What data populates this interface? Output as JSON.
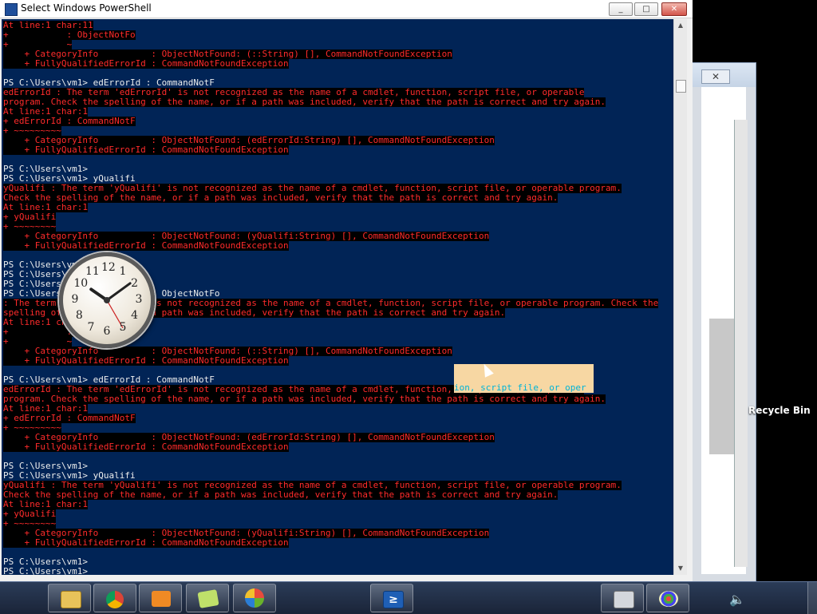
{
  "window": {
    "title": "Select Windows PowerShell",
    "minimize_label": "_",
    "maximize_label": "□",
    "close_label": "✕"
  },
  "console": {
    "lines": [
      {
        "t": "At line:1 char:11",
        "k": "err"
      },
      {
        "t": "+           : ObjectNotFo",
        "k": "err"
      },
      {
        "t": "+           ~",
        "k": "err"
      },
      {
        "t": "    + CategoryInfo          : ObjectNotFound: (::String) [], CommandNotFoundException",
        "k": "err"
      },
      {
        "t": "    + FullyQualifiedErrorId : CommandNotFoundException",
        "k": "err"
      },
      {
        "t": "",
        "k": "norm"
      },
      {
        "t": "PS C:\\Users\\vm1> edErrorId : CommandNotF",
        "k": "norm"
      },
      {
        "t": "edErrorId : The term 'edErrorId' is not recognized as the name of a cmdlet, function, script file, or operable",
        "k": "err"
      },
      {
        "t": "program. Check the spelling of the name, or if a path was included, verify that the path is correct and try again.",
        "k": "err"
      },
      {
        "t": "At line:1 char:1",
        "k": "err"
      },
      {
        "t": "+ edErrorId : CommandNotF",
        "k": "err"
      },
      {
        "t": "+ ~~~~~~~~~",
        "k": "err"
      },
      {
        "t": "    + CategoryInfo          : ObjectNotFound: (edErrorId:String) [], CommandNotFoundException",
        "k": "err"
      },
      {
        "t": "    + FullyQualifiedErrorId : CommandNotFoundException",
        "k": "err"
      },
      {
        "t": "",
        "k": "norm"
      },
      {
        "t": "PS C:\\Users\\vm1>",
        "k": "norm"
      },
      {
        "t": "PS C:\\Users\\vm1> yQualifi",
        "k": "norm"
      },
      {
        "t": "yQualifi : The term 'yQualifi' is not recognized as the name of a cmdlet, function, script file, or operable program.",
        "k": "err"
      },
      {
        "t": "Check the spelling of the name, or if a path was included, verify that the path is correct and try again.",
        "k": "err"
      },
      {
        "t": "At line:1 char:1",
        "k": "err"
      },
      {
        "t": "+ yQualifi",
        "k": "err"
      },
      {
        "t": "+ ~~~~~~~~",
        "k": "err"
      },
      {
        "t": "    + CategoryInfo          : ObjectNotFound: (yQualifi:String) [], CommandNotFoundException",
        "k": "err"
      },
      {
        "t": "    + FullyQualifiedErrorId : CommandNotFoundException",
        "k": "err"
      },
      {
        "t": "",
        "k": "norm"
      },
      {
        "t": "PS C:\\Users\\vm1>",
        "k": "norm"
      },
      {
        "t": "PS C:\\Users\\vm1>",
        "k": "norm"
      },
      {
        "t": "PS C:\\Users\\vm1>",
        "k": "norm"
      },
      {
        "t": "PS C:\\Users\\vm1>            : ObjectNotFo",
        "k": "norm"
      },
      {
        "t": ": The term ' : ObjectNotFo' is not recognized as the name of a cmdlet, function, script file, or operable program. Check the",
        "k": "err"
      },
      {
        "t": "spelling of the name, or if a path was included, verify that the path is correct and try again.",
        "k": "err"
      },
      {
        "t": "At line:1 char:11",
        "k": "err"
      },
      {
        "t": "+           : ObjectNotFo",
        "k": "err"
      },
      {
        "t": "+           ~",
        "k": "err"
      },
      {
        "t": "    + CategoryInfo          : ObjectNotFound: (::String) [], CommandNotFoundException",
        "k": "err"
      },
      {
        "t": "    + FullyQualifiedErrorId : CommandNotFoundException",
        "k": "err"
      },
      {
        "t": "",
        "k": "norm"
      },
      {
        "t": "PS C:\\Users\\vm1> edErrorId : CommandNotF",
        "k": "norm"
      },
      {
        "t": "edErrorId : The term 'edErrorId' is not recognized as the name of a cmdlet, function, script file, or operable",
        "k": "err"
      },
      {
        "t": "program. Check the spelling of the name, or if a path was included, verify that the path is correct and try again.",
        "k": "err"
      },
      {
        "t": "At line:1 char:1",
        "k": "err"
      },
      {
        "t": "+ edErrorId : CommandNotF",
        "k": "err"
      },
      {
        "t": "+ ~~~~~~~~~",
        "k": "err"
      },
      {
        "t": "    + CategoryInfo          : ObjectNotFound: (edErrorId:String) [], CommandNotFoundException",
        "k": "err"
      },
      {
        "t": "    + FullyQualifiedErrorId : CommandNotFoundException",
        "k": "err"
      },
      {
        "t": "",
        "k": "norm"
      },
      {
        "t": "PS C:\\Users\\vm1>",
        "k": "norm"
      },
      {
        "t": "PS C:\\Users\\vm1> yQualifi",
        "k": "norm"
      },
      {
        "t": "yQualifi : The term 'yQualifi' is not recognized as the name of a cmdlet, function, script file, or operable program.",
        "k": "err"
      },
      {
        "t": "Check the spelling of the name, or if a path was included, verify that the path is correct and try again.",
        "k": "err"
      },
      {
        "t": "At line:1 char:1",
        "k": "err"
      },
      {
        "t": "+ yQualifi",
        "k": "err"
      },
      {
        "t": "+ ~~~~~~~~",
        "k": "err"
      },
      {
        "t": "    + CategoryInfo          : ObjectNotFound: (yQualifi:String) [], CommandNotFoundException",
        "k": "err"
      },
      {
        "t": "    + FullyQualifiedErrorId : CommandNotFoundException",
        "k": "err"
      },
      {
        "t": "",
        "k": "norm"
      },
      {
        "t": "PS C:\\Users\\vm1>",
        "k": "norm"
      },
      {
        "t": "PS C:\\Users\\vm1>",
        "k": "norm"
      }
    ],
    "selection_text": "ion, script file, or oper"
  },
  "clock": {
    "numerals": [
      "12",
      "1",
      "2",
      "3",
      "4",
      "5",
      "6",
      "7",
      "8",
      "9",
      "10",
      "11"
    ],
    "hour": 10,
    "minute": 9,
    "second": 25
  },
  "desktop": {
    "recycle_bin_label": "Recycle Bin"
  },
  "taskbar": {
    "apps": [
      {
        "name": "explorer",
        "icon": "folder-icon"
      },
      {
        "name": "chrome",
        "icon": "chrome-icon"
      },
      {
        "name": "media",
        "icon": "media-player-icon"
      },
      {
        "name": "notes",
        "icon": "sticky-notes-icon"
      },
      {
        "name": "start",
        "icon": "windows-start-icon"
      },
      {
        "name": "powershell",
        "icon": "powershell-icon",
        "glyph": "≥"
      },
      {
        "name": "calculator",
        "icon": "calculator-icon"
      },
      {
        "name": "paint",
        "icon": "paint-icon"
      }
    ]
  },
  "colors": {
    "console_bg": "#012456",
    "error_fg": "#ff2b2b",
    "selection_bg": "#f7d7a3"
  }
}
